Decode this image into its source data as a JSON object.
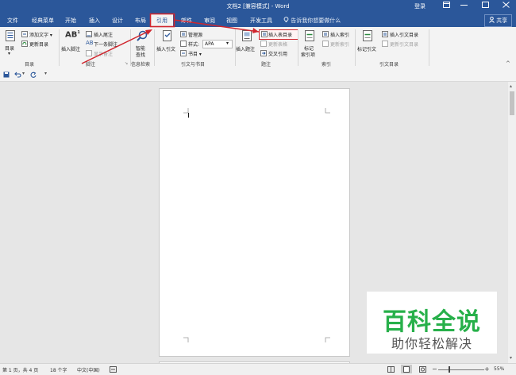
{
  "window": {
    "title": "文档2 [兼容模式] - Word",
    "login": "登录",
    "controls": [
      "restore-ribbon",
      "minimize",
      "maximize",
      "close"
    ]
  },
  "tabs": [
    {
      "label": "文件"
    },
    {
      "label": "经典菜单"
    },
    {
      "label": "开始"
    },
    {
      "label": "插入"
    },
    {
      "label": "设计"
    },
    {
      "label": "布局"
    },
    {
      "label": "引用",
      "active": true
    },
    {
      "label": "邮件"
    },
    {
      "label": "审阅"
    },
    {
      "label": "视图"
    },
    {
      "label": "开发工具"
    }
  ],
  "tellme": "告诉我你想要做什么",
  "share": "共享",
  "ribbon": {
    "toc": {
      "button": "目录",
      "add_text": "添加文字 ▾",
      "update_toc": "更新目录",
      "group": "目录"
    },
    "footnotes": {
      "insert_footnote": "插入脚注",
      "insert_endnote": "插入尾注",
      "next_footnote": "下一条脚注",
      "show_notes": "显示备注",
      "group": "脚注"
    },
    "research": {
      "smart_lookup_1": "智能",
      "smart_lookup_2": "查找",
      "group": "信息检索"
    },
    "citations": {
      "insert_citation": "插入引文",
      "manage_sources": "管理源",
      "style_label": "样式:",
      "style_value": "APA",
      "bibliography": "书目 ▾",
      "group": "引文与书目"
    },
    "captions": {
      "insert_caption": "插入题注",
      "insert_table_of_figures": "插入表目录",
      "update_table": "更新表格",
      "cross_reference": "交叉引用",
      "group": "题注"
    },
    "index": {
      "mark_entry_1": "标记",
      "mark_entry_2": "索引项",
      "insert_index": "插入索引",
      "update_index": "更新索引",
      "group": "索引"
    },
    "toa": {
      "mark_citation": "标记引文",
      "insert_toa": "插入引文目录",
      "update_toa": "更新引文目录",
      "group": "引文目录"
    }
  },
  "status": {
    "page": "第 1 页，共 4 页",
    "words": "18 个字",
    "language": "中文(中国)",
    "zoom": "55%"
  },
  "watermark": {
    "title": "百科全说",
    "subtitle": "助你轻松解决"
  },
  "colors": {
    "titlebar": "#2b579a",
    "annotation": "#d0252d",
    "watermark_green": "#27b04a"
  }
}
